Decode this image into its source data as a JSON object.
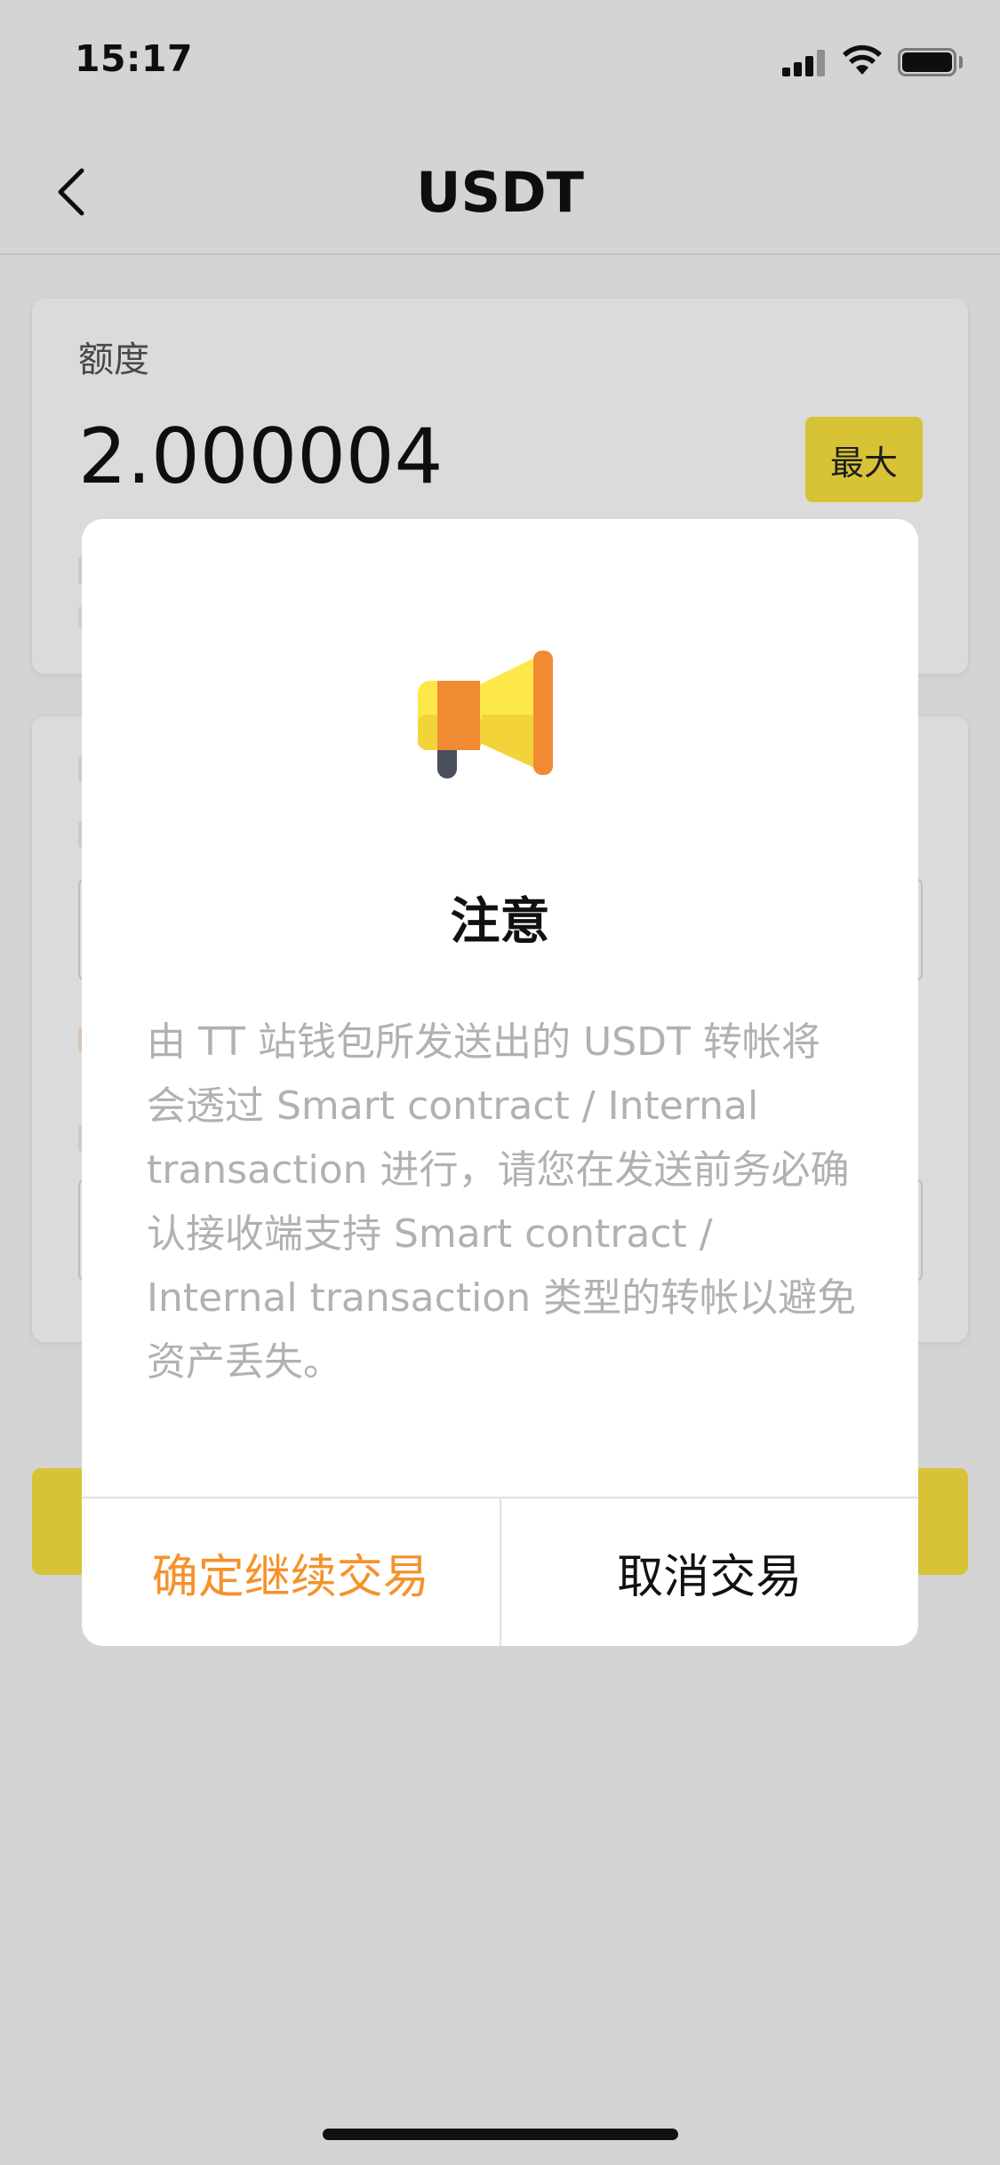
{
  "status_bar": {
    "time": "15:17",
    "icons": [
      "signal-icon",
      "wifi-icon",
      "battery-icon"
    ]
  },
  "nav": {
    "back_icon": "chevron-left-icon",
    "title": "USDT"
  },
  "amount_card": {
    "label": "额度",
    "value": "2.000004",
    "max_label": "最大"
  },
  "dialog": {
    "icon": "megaphone-icon",
    "title": "注意",
    "message": "由 TT 站钱包所发送出的 USDT 转帐将会透过 Smart contract / Internal transaction 进行，请您在发送前务必确认接收端支持 Smart contract / Internal transaction 类型的转帐以避免资产丢失。",
    "confirm_label": "确定继续交易",
    "cancel_label": "取消交易"
  },
  "colors": {
    "accent_yellow": "#fce33f",
    "confirm_orange": "#f5922a",
    "message_gray": "#b1b1b1"
  }
}
